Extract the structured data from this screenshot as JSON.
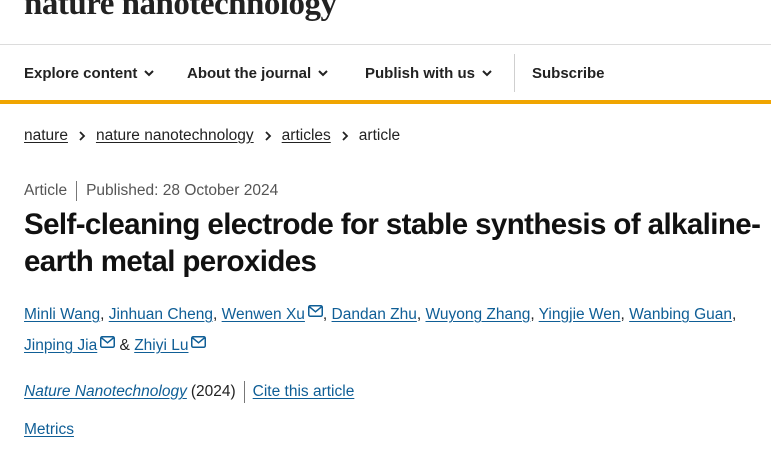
{
  "site": {
    "logo": "nature nanotechnology"
  },
  "nav": {
    "items": [
      {
        "label": "Explore content",
        "has_dropdown": true
      },
      {
        "label": "About the journal",
        "has_dropdown": true
      },
      {
        "label": "Publish with us",
        "has_dropdown": true
      },
      {
        "label": "Subscribe",
        "has_dropdown": false
      }
    ]
  },
  "breadcrumb": [
    {
      "label": "nature",
      "link": true
    },
    {
      "label": "nature nanotechnology",
      "link": true
    },
    {
      "label": "articles",
      "link": true
    },
    {
      "label": "article",
      "link": false
    }
  ],
  "article": {
    "type": "Article",
    "published": "Published: 28 October 2024",
    "title": "Self-cleaning electrode for stable synthesis of alkaline-earth metal peroxides",
    "authors": [
      {
        "name": "Minli Wang",
        "email": false
      },
      {
        "name": "Jinhuan Cheng",
        "email": false
      },
      {
        "name": "Wenwen Xu",
        "email": true
      },
      {
        "name": "Dandan Zhu",
        "email": false
      },
      {
        "name": "Wuyong Zhang",
        "email": false
      },
      {
        "name": "Yingjie Wen",
        "email": false
      },
      {
        "name": "Wanbing Guan",
        "email": false
      },
      {
        "name": "Jinping Jia",
        "email": true
      },
      {
        "name": "Zhiyi Lu",
        "email": true
      }
    ],
    "author_separator": ",",
    "author_last_joiner": "&",
    "journal": "Nature Nanotechnology",
    "year": "(2024)",
    "cite_label": "Cite this article",
    "metrics_label": "Metrics"
  },
  "colors": {
    "accent": "#f0a500",
    "link": "#0f5e96",
    "text": "#222222"
  },
  "icons": {
    "dropdown": "chevron-down-icon",
    "breadcrumb_sep": "chevron-right-icon",
    "email": "envelope-icon"
  }
}
